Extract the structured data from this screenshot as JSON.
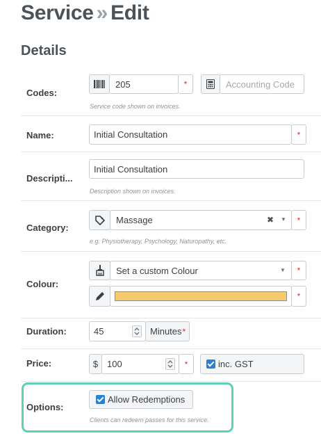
{
  "page": {
    "title_part1": "Service",
    "title_sep": "»",
    "title_part2": "Edit",
    "section": "Details"
  },
  "codes": {
    "label": "Codes:",
    "barcode_icon": "barcode-icon",
    "code_value": "205",
    "required": "*",
    "calculator_icon": "calculator-icon",
    "accounting_placeholder": "Accounting Code",
    "help": "Service code shown on invoices."
  },
  "name": {
    "label": "Name:",
    "value": "Initial Consultation",
    "required": "*"
  },
  "description": {
    "label": "Descripti...",
    "value": "Initial Consultation",
    "help": "Description shown on invoices."
  },
  "category": {
    "label": "Category:",
    "tag_icon": "tag-icon",
    "value": "Massage",
    "clear": "✖",
    "caret": "▼",
    "required": "*",
    "help": "e.g. Physiotherapy, Psychology, Naturopathy, etc."
  },
  "colour": {
    "label": "Colour:",
    "brush_icon": "paint-brush-icon",
    "value": "Set a custom Colour",
    "caret": "▼",
    "required": "*",
    "pencil_icon": "pencil-icon",
    "swatch_color": "#f3cb6c"
  },
  "duration": {
    "label": "Duration:",
    "value": "45",
    "unit": "Minutes",
    "required": "*"
  },
  "price": {
    "label": "Price:",
    "currency": "$",
    "value": "100",
    "required": "*",
    "gst_label": "inc. GST",
    "gst_checked": true
  },
  "options": {
    "label": "Options:",
    "allow_label": "Allow Redemptions",
    "allow_checked": true,
    "help": "Clients can redeem passes for this service."
  },
  "colors": {
    "highlight": "#5ed1b3",
    "checkbox": "#2b7fd4",
    "required": "#d9302c"
  }
}
